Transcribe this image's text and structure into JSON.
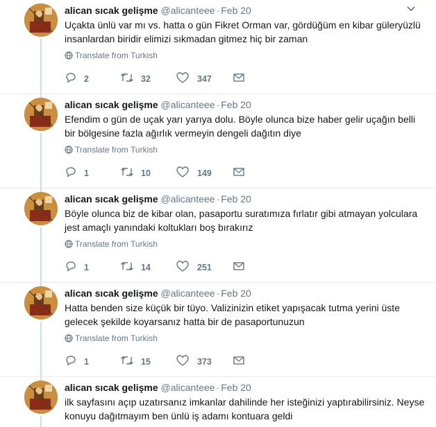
{
  "author": {
    "name": "alican sıcak gelişme",
    "handle": "@alicanteee"
  },
  "translate_label": "Translate from Turkish",
  "tweets": [
    {
      "date": "Feb 20",
      "text": "Uçakta ünlü var mı vs. hatta o gün Fikret Orman var, gördüğüm en kibar güleryüzlü insanlardan biridir elimizi sıkmadan gitmez hiç bir zaman",
      "replies": "2",
      "retweets": "32",
      "likes": "347"
    },
    {
      "date": "Feb 20",
      "text": "Efendim o gün de uçak yarı yarıya dolu. Böyle olunca bize haber gelir uçağın belli bir bölgesine fazla ağırlık vermeyin dengeli dağıtın diye",
      "replies": "1",
      "retweets": "10",
      "likes": "149"
    },
    {
      "date": "Feb 20",
      "text": "Böyle olunca biz de kibar olan, pasaportu suratımıza fırlatır gibi atmayan yolculara jest amaçlı yanındaki koltukları boş bırakırız",
      "replies": "1",
      "retweets": "14",
      "likes": "251"
    },
    {
      "date": "Feb 20",
      "text": "Hatta benden size küçük bir tüyo. Valizinizin etiket yapışacak tutma yerini üste gelecek şekilde koyarsanız hatta bir de pasaportunuzun",
      "replies": "1",
      "retweets": "15",
      "likes": "373"
    },
    {
      "date": "Feb 20",
      "text": "ilk sayfasını açıp uzatırsanız imkanlar dahilinde her isteğinizi yaptırabilirsiniz. Neyse konuyu dağıtmayım ben ünlü iş adamı kontuara geldi"
    }
  ],
  "colors": {
    "thread_line": "#c4dff5",
    "secondary_text": "#657786",
    "avatar_bg": "#c98e3f"
  }
}
